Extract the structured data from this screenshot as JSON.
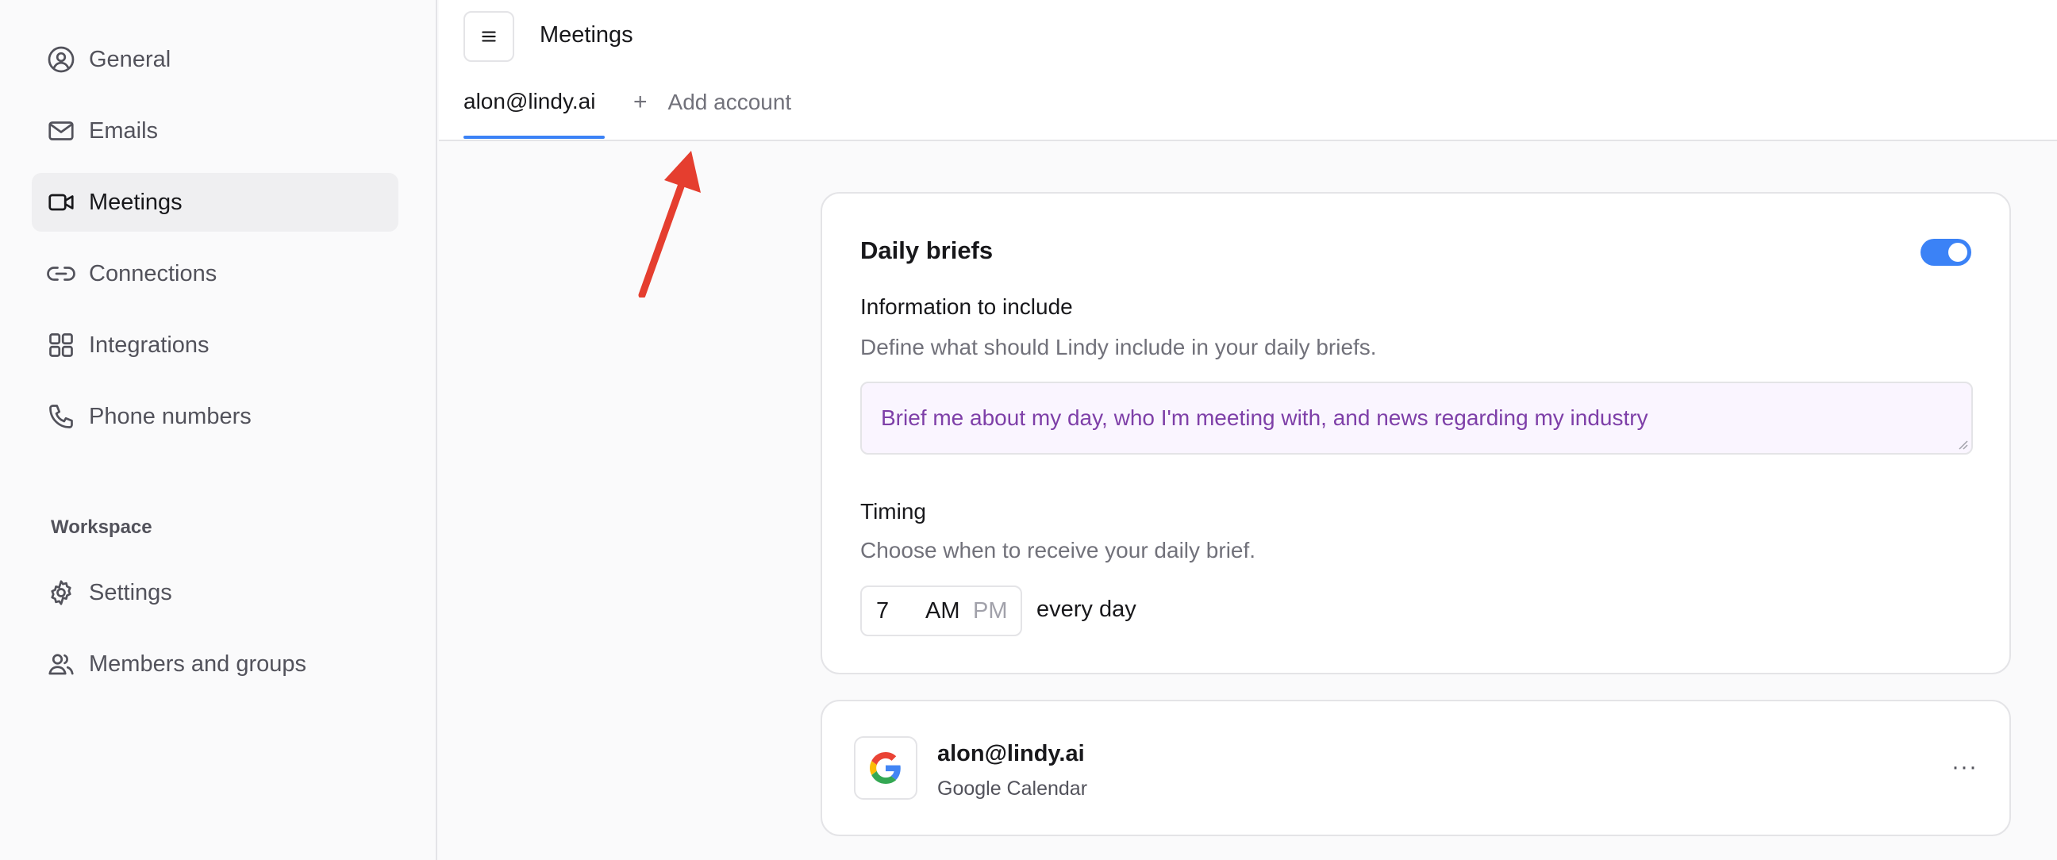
{
  "sidebar": {
    "items": [
      {
        "label": "General",
        "icon": "user-circle-icon"
      },
      {
        "label": "Emails",
        "icon": "mail-icon"
      },
      {
        "label": "Meetings",
        "icon": "video-icon"
      },
      {
        "label": "Connections",
        "icon": "link-icon"
      },
      {
        "label": "Integrations",
        "icon": "grid-icon"
      },
      {
        "label": "Phone numbers",
        "icon": "phone-icon"
      }
    ],
    "section_label": "Workspace",
    "workspace_items": [
      {
        "label": "Settings",
        "icon": "gear-icon"
      },
      {
        "label": "Members and groups",
        "icon": "users-icon"
      }
    ],
    "active_item": "Meetings"
  },
  "header": {
    "title": "Meetings",
    "tabs": {
      "account": "alon@lindy.ai",
      "add_plus": "+",
      "add_account": "Add account"
    }
  },
  "daily_briefs": {
    "title": "Daily briefs",
    "enabled": true,
    "info_label": "Information to include",
    "info_help": "Define what should Lindy include in your daily briefs.",
    "info_value": "Brief me about my day, who I'm meeting with, and news regarding my industry",
    "timing_label": "Timing",
    "timing_help": "Choose when to receive your daily brief.",
    "hour": "7",
    "am": "AM",
    "pm": "PM",
    "selected_period": "AM",
    "frequency": "every day"
  },
  "account_card": {
    "email": "alon@lindy.ai",
    "service": "Google Calendar",
    "more": "···",
    "icon": "google-icon"
  },
  "colors": {
    "accent": "#3b82f6",
    "annotation_arrow": "#e53e2f",
    "textarea_text": "#7e3fa8"
  }
}
